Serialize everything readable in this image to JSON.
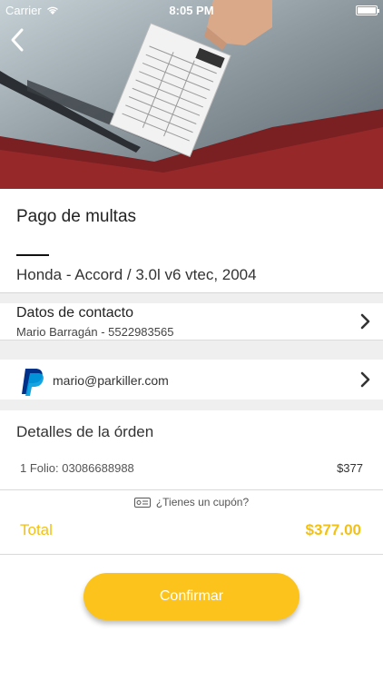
{
  "status_bar": {
    "carrier": "Carrier",
    "time": "8:05 PM"
  },
  "header": {
    "back_icon": "chevron-left-icon"
  },
  "page": {
    "title": "Pago de multas",
    "vehicle": "Honda - Accord / 3.0l v6 vtec, 2004"
  },
  "contact": {
    "title": "Datos de contacto",
    "subtitle": "Mario Barragán - 5522983565"
  },
  "payment": {
    "method_icon": "paypal-icon",
    "email": "mario@parkiller.com"
  },
  "order": {
    "title": "Detalles de la órden",
    "items": [
      {
        "label": "1 Folio: 03086688988",
        "price": "$377"
      }
    ]
  },
  "coupon": {
    "label": "¿Tienes un cupón?"
  },
  "total": {
    "label": "Total",
    "value": "$377.00"
  },
  "actions": {
    "confirm_label": "Confirmar"
  },
  "colors": {
    "accent": "#fcc31d",
    "total_text": "#f2c114",
    "paypal_dark": "#003087",
    "paypal_light": "#009cde"
  }
}
